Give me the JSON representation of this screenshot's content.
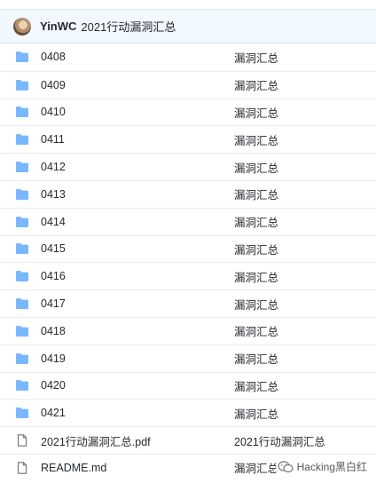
{
  "header": {
    "user": "YinWC",
    "message": "2021行动漏洞汇总"
  },
  "files": [
    {
      "name": "0408",
      "message": "漏洞汇总",
      "icon": "folder-icon"
    },
    {
      "name": "0409",
      "message": "漏洞汇总",
      "icon": "folder-icon"
    },
    {
      "name": "0410",
      "message": "漏洞汇总",
      "icon": "folder-icon"
    },
    {
      "name": "0411",
      "message": "漏洞汇总",
      "icon": "folder-icon"
    },
    {
      "name": "0412",
      "message": "漏洞汇总",
      "icon": "folder-icon"
    },
    {
      "name": "0413",
      "message": "漏洞汇总",
      "icon": "folder-icon"
    },
    {
      "name": "0414",
      "message": "漏洞汇总",
      "icon": "folder-icon"
    },
    {
      "name": "0415",
      "message": "漏洞汇总",
      "icon": "folder-icon"
    },
    {
      "name": "0416",
      "message": "漏洞汇总",
      "icon": "folder-icon"
    },
    {
      "name": "0417",
      "message": "漏洞汇总",
      "icon": "folder-icon"
    },
    {
      "name": "0418",
      "message": "漏洞汇总",
      "icon": "folder-icon"
    },
    {
      "name": "0419",
      "message": "漏洞汇总",
      "icon": "folder-icon"
    },
    {
      "name": "0420",
      "message": "漏洞汇总",
      "icon": "folder-icon"
    },
    {
      "name": "0421",
      "message": "漏洞汇总",
      "icon": "folder-icon"
    },
    {
      "name": "2021行动漏洞汇总.pdf",
      "message": "2021行动漏洞汇总",
      "icon": "file-icon"
    },
    {
      "name": "README.md",
      "message": "漏洞汇总",
      "icon": "file-icon"
    }
  ],
  "watermark": "Hacking黑白红",
  "colors": {
    "folder": "#79b8ff",
    "file": "#6a737d",
    "header_bg": "#f1f8ff"
  }
}
